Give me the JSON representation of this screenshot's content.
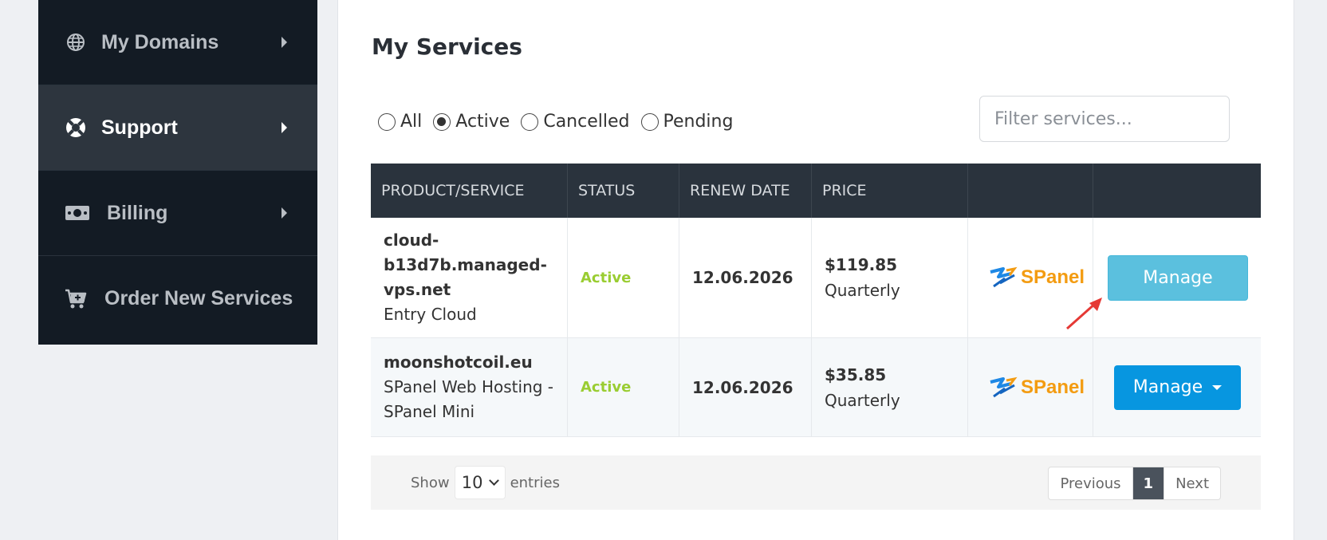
{
  "sidebar": {
    "items": [
      {
        "label": "My Domains",
        "icon": "globe-icon",
        "active": false
      },
      {
        "label": "Support",
        "icon": "lifebuoy-icon",
        "active": true
      },
      {
        "label": "Billing",
        "icon": "money-icon",
        "active": false
      },
      {
        "label": "Order New Services",
        "icon": "cart-plus-icon",
        "active": false
      }
    ]
  },
  "main": {
    "title": "My Services",
    "filters": [
      "All",
      "Active",
      "Cancelled",
      "Pending"
    ],
    "selected_filter": "Active",
    "search_placeholder": "Filter services..."
  },
  "table": {
    "headers": [
      "PRODUCT/SERVICE",
      "STATUS",
      "RENEW DATE",
      "PRICE",
      "",
      ""
    ],
    "rows": [
      {
        "name": "cloud-b13d7b.managed-vps.net",
        "name_lines": [
          "cloud-",
          "b13d7b.managed-",
          "vps.net"
        ],
        "plan": "Entry Cloud",
        "status": "Active",
        "renew": "12.06.2026",
        "price": "$119.85",
        "cycle": "Quarterly",
        "logo": "SPanel",
        "action": "Manage"
      },
      {
        "name": "moonshotcoil.eu",
        "plan_lines": [
          "SPanel Web Hosting -",
          "SPanel Mini"
        ],
        "status": "Active",
        "renew": "12.06.2026",
        "price": "$35.85",
        "cycle": "Quarterly",
        "logo": "SPanel",
        "action": "Manage"
      }
    ]
  },
  "footer": {
    "show": "Show",
    "entries_value": "10",
    "entries": "entries",
    "prev": "Previous",
    "page": "1",
    "next": "Next"
  },
  "colors": {
    "sidebar_bg": "#131b24",
    "header_bg": "#2a333d",
    "status_active": "#9acd32",
    "button_info": "#5bc0de",
    "button_primary": "#0796e0",
    "logo_orange": "#f39c12",
    "logo_blue": "#1e88e5",
    "annotation_arrow": "#e53935"
  }
}
